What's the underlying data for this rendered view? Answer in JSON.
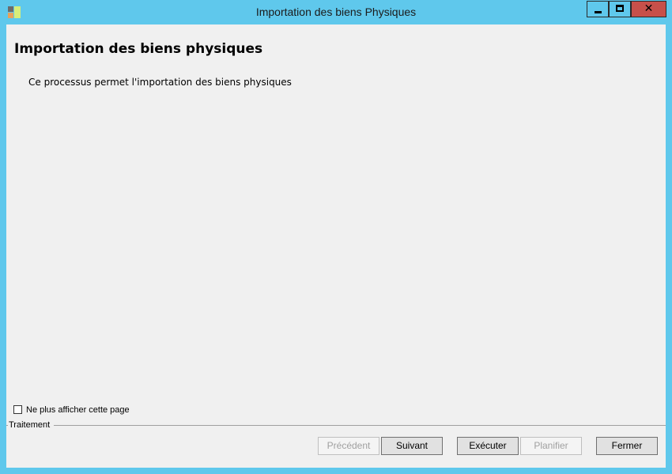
{
  "window": {
    "title": "Importation des biens Physiques",
    "icon": "app-icon",
    "controls": {
      "minimize": "minimize-icon",
      "maximize": "maximize-icon",
      "close": "close-icon",
      "close_glyph": "✕"
    }
  },
  "page": {
    "heading": "Importation des biens physiques",
    "description": "Ce processus permet l'importation des biens physiques"
  },
  "options": {
    "dont_show_label": "Ne plus afficher cette page",
    "dont_show_checked": false
  },
  "group": {
    "label": "Traitement"
  },
  "buttons": {
    "previous": "Précédent",
    "next": "Suivant",
    "execute": "Exécuter",
    "schedule": "Planifier",
    "close": "Fermer"
  },
  "colors": {
    "frame": "#5fc8ec",
    "client_background": "#f0f0f0",
    "close_button": "#c7504a"
  }
}
